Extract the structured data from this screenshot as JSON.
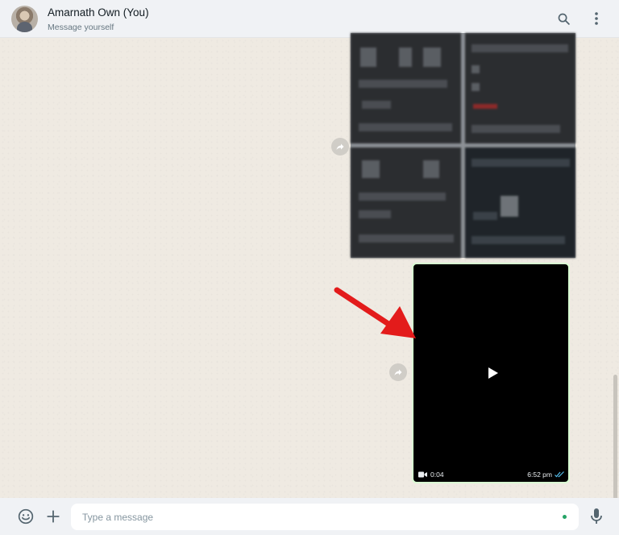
{
  "header": {
    "title": "Amarnath Own (You)",
    "subtitle": "Message yourself",
    "icons": {
      "avatar": "profile-photo",
      "search": "search-icon",
      "menu": "kebab-menu-icon"
    }
  },
  "album": {
    "tiles": 4,
    "content": "blurred screenshots"
  },
  "video_message": {
    "duration": "0:04",
    "time": "6:52 pm",
    "status": "read",
    "icons": {
      "type": "video-camera-icon",
      "play": "play-icon",
      "ticks": "double-check-icon"
    }
  },
  "annotation": {
    "type": "arrow",
    "color": "#e31b1b"
  },
  "composer": {
    "placeholder": "Type a message",
    "icons": {
      "emoji": "emoji-icon",
      "attach": "plus-icon",
      "voice": "microphone-icon"
    }
  },
  "colors": {
    "chat_background": "#efeae2",
    "header_background": "#f0f2f5",
    "accent": "#25a366",
    "read_ticks": "#53bdeb"
  }
}
